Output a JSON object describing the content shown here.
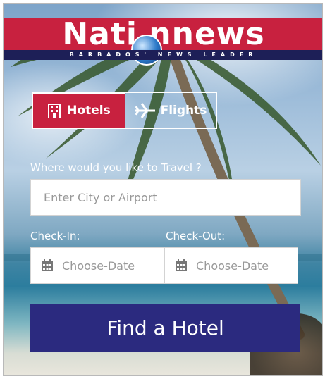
{
  "brand": {
    "name": "Nati nnews",
    "tagline": "BARBADOS' NEWS LEADER",
    "color": "#c8213f",
    "tagline_bg": "#1d1f57"
  },
  "tabs": [
    {
      "label": "Hotels",
      "icon": "hotel-building-icon",
      "active": true
    },
    {
      "label": "Flights",
      "icon": "airplane-icon",
      "active": false
    }
  ],
  "search": {
    "destination_label": "Where would you like to Travel ?",
    "destination_placeholder": "Enter City or Airport",
    "checkin_label": "Check-In:",
    "checkin_placeholder": "Choose-Date",
    "checkout_label": "Check-Out:",
    "checkout_placeholder": "Choose-Date",
    "submit_label": "Find a Hotel",
    "submit_color": "#2b2a7f"
  }
}
